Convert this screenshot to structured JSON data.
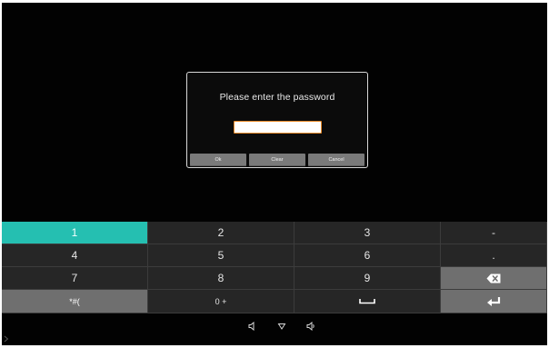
{
  "dialog": {
    "title": "Please enter the password",
    "input_value": "",
    "buttons": {
      "ok": "Ok",
      "clear": "Clear",
      "cancel": "Cancel"
    }
  },
  "keyboard": {
    "rows": [
      [
        "1",
        "2",
        "3",
        "-"
      ],
      [
        "4",
        "5",
        "6",
        "."
      ],
      [
        "7",
        "8",
        "9",
        "backspace-icon"
      ],
      [
        "*#(",
        "0 +",
        "space-icon",
        "enter-icon"
      ]
    ],
    "active_key": "1"
  },
  "navbar": {
    "icons": [
      "volume-down-icon",
      "back-icon",
      "volume-up-icon"
    ]
  },
  "colors": {
    "background": "#020202",
    "accent_key": "#25bfb1",
    "input_border": "#e88a2a",
    "dialog_button": "#7a7a7a"
  }
}
